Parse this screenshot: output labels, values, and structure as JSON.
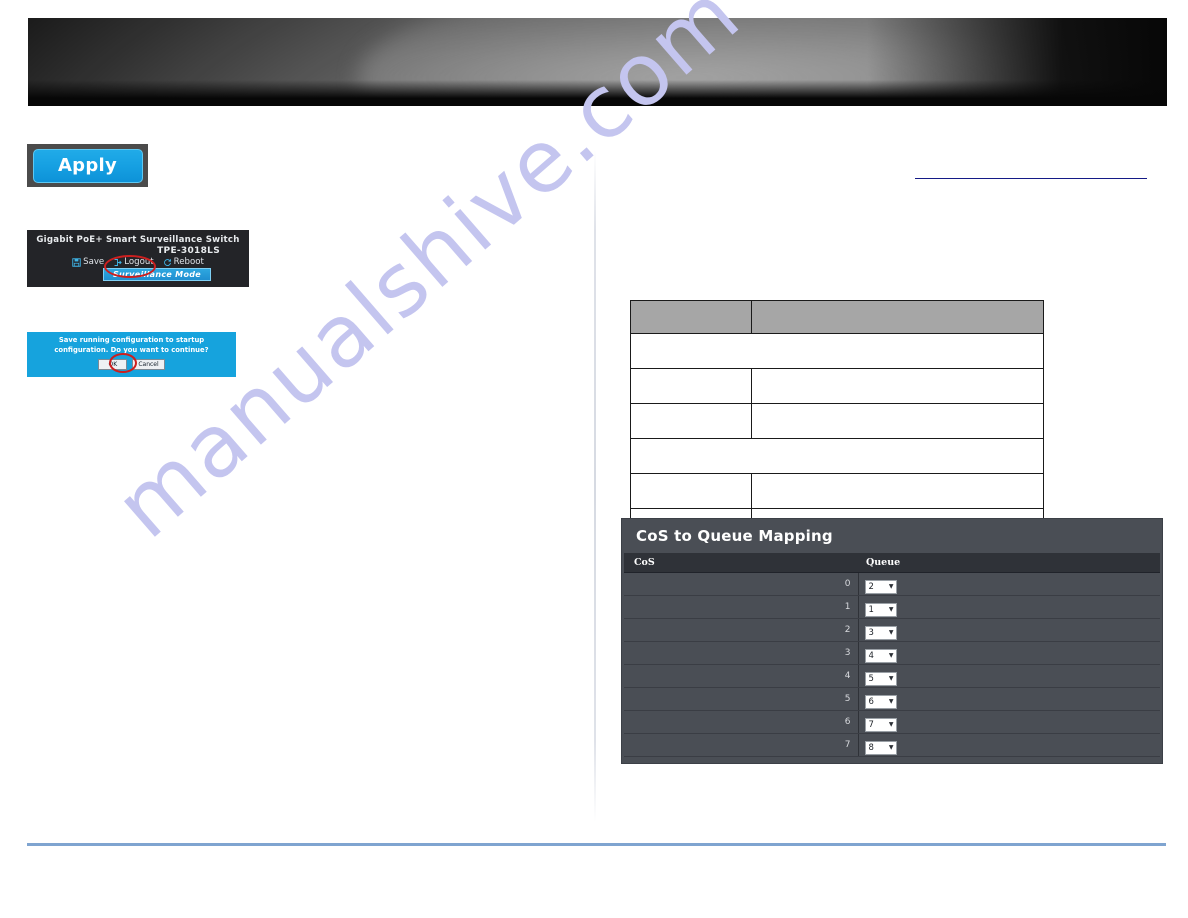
{
  "page": {
    "watermark": "manualshive.com"
  },
  "banner": {
    "name": "top-banner"
  },
  "figures": {
    "apply": {
      "button_label": "Apply"
    },
    "switch_header": {
      "product_title": "Gigabit PoE+ Smart Surveillance Switch",
      "model": "TPE-3018LS",
      "actions": [
        {
          "label": "Save",
          "icon": "save-icon"
        },
        {
          "label": "Logout",
          "icon": "logout-icon"
        },
        {
          "label": "Reboot",
          "icon": "reboot-icon"
        }
      ],
      "mode_button": "Surveillance Mode",
      "annotation": "red-ellipse-around-save"
    },
    "save_dialog": {
      "message": "Save running configuration to startup configuration. Do you want to continue?",
      "ok_label": "OK",
      "cancel_label": "Cancel",
      "annotation": "red-ellipse-around-ok"
    }
  },
  "spec_table": {
    "headers": [
      "",
      ""
    ],
    "rows": [
      {
        "type": "full",
        "cells": [
          ""
        ]
      },
      {
        "type": "split",
        "cells": [
          "",
          ""
        ]
      },
      {
        "type": "split",
        "cells": [
          "",
          ""
        ]
      },
      {
        "type": "full",
        "cells": [
          ""
        ]
      },
      {
        "type": "split",
        "cells": [
          "",
          ""
        ]
      },
      {
        "type": "split",
        "cells": [
          "",
          ""
        ]
      }
    ]
  },
  "cos_panel": {
    "title": "CoS to Queue Mapping",
    "columns": [
      "CoS",
      "Queue"
    ],
    "rows": [
      {
        "cos": "0",
        "queue": "2"
      },
      {
        "cos": "1",
        "queue": "1"
      },
      {
        "cos": "2",
        "queue": "3"
      },
      {
        "cos": "3",
        "queue": "4"
      },
      {
        "cos": "4",
        "queue": "5"
      },
      {
        "cos": "5",
        "queue": "6"
      },
      {
        "cos": "6",
        "queue": "7"
      },
      {
        "cos": "7",
        "queue": "8"
      }
    ]
  },
  "colors": {
    "accent_blue": "#16a3dd",
    "panel_dark": "#4a4e55",
    "header_dark": "#2f3238",
    "annotation_red": "#cc1f1f",
    "footer_rule": "#7fa4d0",
    "link_underline": "#141a86"
  }
}
